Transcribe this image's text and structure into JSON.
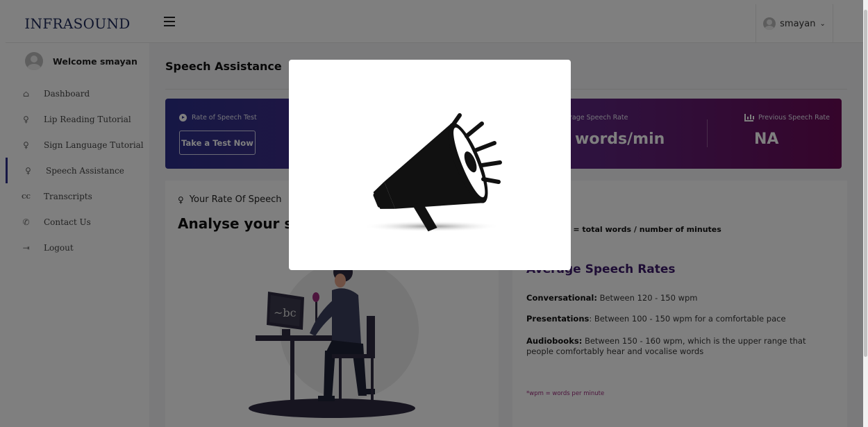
{
  "brand": "INFRASOUND",
  "user_menu": {
    "username": "smayan"
  },
  "sidebar": {
    "welcome": "Welcome smayan",
    "items": [
      {
        "label": "Dashboard",
        "icon": "home-icon"
      },
      {
        "label": "Lip Reading Tutorial",
        "icon": "mic-icon"
      },
      {
        "label": "Sign Language Tutorial",
        "icon": "mic-icon"
      },
      {
        "label": "Speech Assistance",
        "icon": "mic-icon"
      },
      {
        "label": "Transcripts",
        "icon": "cc-icon"
      },
      {
        "label": "Contact Us",
        "icon": "phone-icon"
      },
      {
        "label": "Logout",
        "icon": "logout-icon"
      }
    ]
  },
  "main": {
    "title": "Speech Assistance",
    "banner": {
      "test_label": "Rate of Speech Test",
      "test_button": "Take a Test Now",
      "avg_label": "rage Speech Rate",
      "avg_value": "words/min",
      "prev_label": "Previous Speech Rate",
      "prev_value": "NA"
    },
    "left_card": {
      "heading": "Your Rate Of Speech",
      "title": "Analyse your sp",
      "illustration_text": "~bc"
    },
    "right_card": {
      "formula": "ate (wpm) = total words / number of minutes",
      "avg_title": "Average Speech Rates",
      "rates": [
        {
          "label": "Conversational:",
          "text": " Between 120 - 150 wpm"
        },
        {
          "label": "Presentations",
          "text": ": Between 100 - 150 wpm for a comfortable pace"
        },
        {
          "label": "Audiobooks:",
          "text": " Between 150 - 160 wpm, which is the upper range that people comfortably hear and vocalise words"
        }
      ],
      "footnote": "*wpm = words per minute"
    }
  },
  "modal": {
    "icon": "megaphone-icon"
  },
  "colors": {
    "brand": "#1f2a5a",
    "banner_start": "#2c2f8a",
    "banner_end": "#6a0a56",
    "accent": "#9a2a7a"
  }
}
